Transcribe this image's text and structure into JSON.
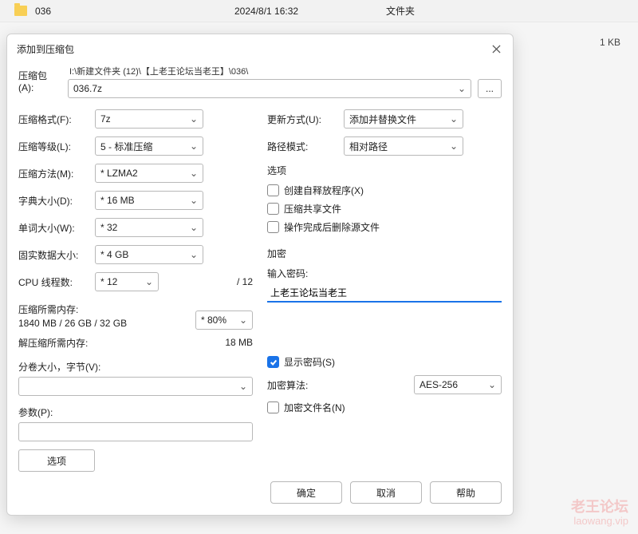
{
  "explorer": {
    "folder_name": "036",
    "date": "2024/8/1 16:32",
    "type": "文件夹",
    "size": "1 KB"
  },
  "dialog": {
    "title": "添加到压缩包",
    "archive_label": "压缩包(A):",
    "path_hint": "I:\\新建文件夹 (12)\\【上老王论坛当老王】\\036\\",
    "archive_value": "036.7z",
    "browse_dots": "...",
    "left": {
      "format_label": "压缩格式(F):",
      "format_value": "7z",
      "level_label": "压缩等级(L):",
      "level_value": "5 - 标准压缩",
      "method_label": "压缩方法(M):",
      "method_value": "* LZMA2",
      "dict_label": "字典大小(D):",
      "dict_value": "* 16 MB",
      "word_label": "单词大小(W):",
      "word_value": "* 32",
      "solid_label": "固实数据大小:",
      "solid_value": "* 4 GB",
      "cpu_label": "CPU 线程数:",
      "cpu_value": "* 12",
      "cpu_total": "/ 12",
      "mem_c_label": "压缩所需内存:",
      "mem_c_value": "1840 MB / 26 GB / 32 GB",
      "mem_pct": "* 80%",
      "mem_d_label": "解压缩所需内存:",
      "mem_d_value": "18 MB",
      "vol_label": "分卷大小，字节(V):",
      "params_label": "参数(P):",
      "options_btn": "选项"
    },
    "right": {
      "update_label": "更新方式(U):",
      "update_value": "添加并替换文件",
      "path_mode_label": "路径模式:",
      "path_mode_value": "相对路径",
      "options_group": "选项",
      "opt_sfx": "创建自释放程序(X)",
      "opt_share": "压缩共享文件",
      "opt_delete": "操作完成后删除源文件",
      "encrypt_group": "加密",
      "pwd_label": "输入密码:",
      "pwd_value": "上老王论坛当老王",
      "show_pwd": "显示密码(S)",
      "algo_label": "加密算法:",
      "algo_value": "AES-256",
      "encrypt_names": "加密文件名(N)"
    },
    "footer": {
      "ok": "确定",
      "cancel": "取消",
      "help": "帮助"
    }
  },
  "watermark": {
    "line1": "老王论坛",
    "line2": "laowang.vip"
  }
}
